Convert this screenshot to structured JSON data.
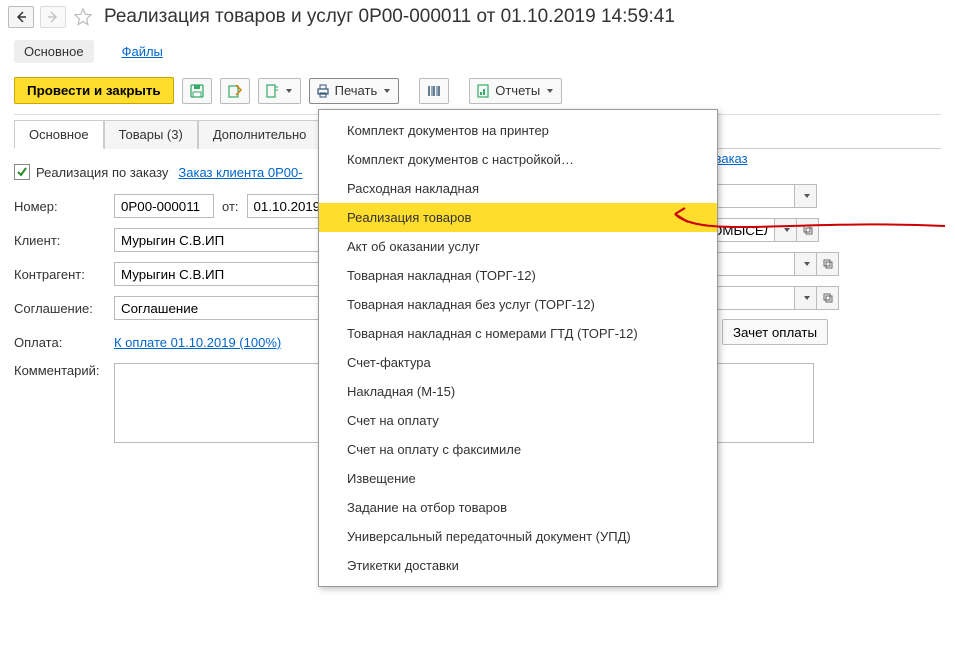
{
  "header": {
    "title": "Реализация товаров и услуг 0Р00-000011 от 01.10.2019 14:59:41"
  },
  "subnav": {
    "main": "Основное",
    "files": "Файлы"
  },
  "toolbar": {
    "post_and_close": "Провести и закрыть",
    "print": "Печать",
    "reports": "Отчеты"
  },
  "tabs": {
    "main": "Основное",
    "goods": "Товары (3)",
    "additional": "Дополнительно"
  },
  "form": {
    "by_order_label": "Реализация по заказу",
    "order_link": "Заказ клиента 0Р00-",
    "right_order_link": "ь заказ",
    "number_label": "Номер:",
    "number_value": "0Р00-000011",
    "from_label": "от:",
    "date_value": "01.10.2019",
    "client_label": "Клиент:",
    "client_value": "Мурыгин С.В.ИП",
    "right_value_partial": "ОМЫСЕЛ",
    "counterparty_label": "Контрагент:",
    "counterparty_value": "Мурыгин С.В.ИП",
    "agreement_label": "Соглашение:",
    "agreement_value": "Соглашение",
    "payment_label": "Оплата:",
    "payment_link": "К оплате 01.10.2019 (100%)",
    "offset_button": "Зачет оплаты",
    "comment_label": "Комментарий:"
  },
  "print_menu": {
    "items": [
      "Комплект документов на принтер",
      "Комплект документов с настройкой…",
      "Расходная накладная",
      "Реализация товаров",
      "Акт об оказании услуг",
      "Товарная накладная (ТОРГ-12)",
      "Товарная накладная без услуг (ТОРГ-12)",
      "Товарная накладная с номерами ГТД (ТОРГ-12)",
      "Счет-фактура",
      "Накладная (М-15)",
      "Счет на оплату",
      "Счет на оплату с факсимиле",
      "Извещение",
      "Задание на отбор товаров",
      "Универсальный передаточный документ (УПД)",
      "Этикетки доставки"
    ],
    "highlighted_index": 3
  }
}
